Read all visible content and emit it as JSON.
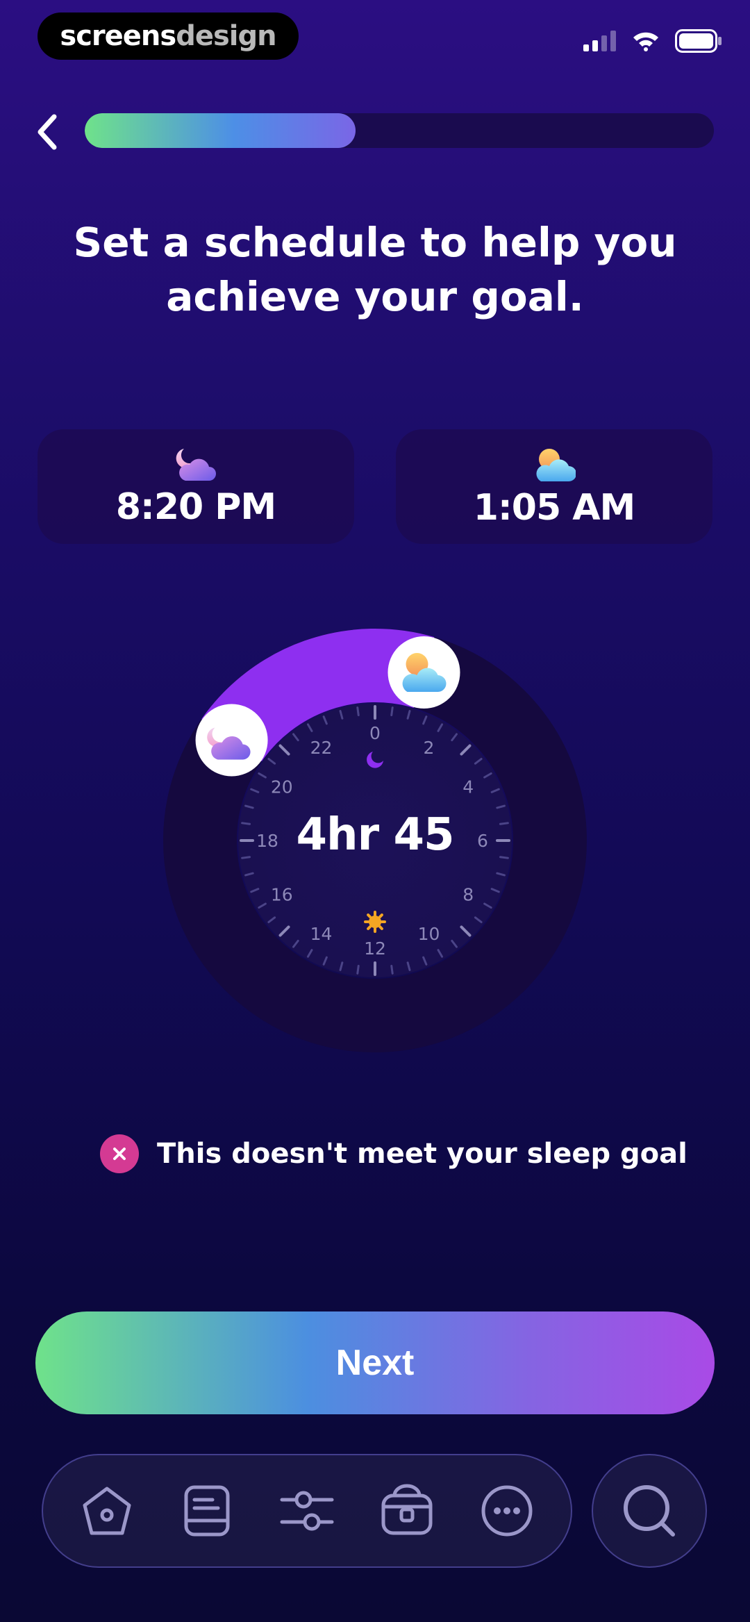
{
  "watermark": {
    "part1": "screens",
    "part2": "design"
  },
  "progress": {
    "fraction": 0.43
  },
  "title": {
    "line1": "Set a schedule to help you",
    "line2": "achieve your goal."
  },
  "bedtime": {
    "time": "8:20 PM",
    "icon": "moon-cloud-icon"
  },
  "wakeup": {
    "time": "1:05 AM",
    "icon": "sun-cloud-icon"
  },
  "dial": {
    "duration": "4hr 45",
    "hour_labels": [
      "0",
      "2",
      "4",
      "6",
      "8",
      "10",
      "12",
      "14",
      "16",
      "18",
      "20",
      "22"
    ],
    "start_hour": 20.333,
    "end_hour": 1.083
  },
  "warning": {
    "message": "This doesn't meet your sleep goal",
    "icon": "close-icon"
  },
  "next_button": {
    "label": "Next"
  },
  "tabbar": {
    "items": [
      {
        "icon": "home-icon"
      },
      {
        "icon": "journal-icon"
      },
      {
        "icon": "sliders-icon"
      },
      {
        "icon": "lock-box-icon"
      },
      {
        "icon": "more-icon"
      }
    ],
    "search_icon": "search-icon"
  },
  "colors": {
    "accent_purple": "#8e2ff0",
    "gradient_green": "#6fe28a",
    "gradient_blue": "#4c8fe0",
    "gradient_violet": "#a94ae6",
    "warning_pink": "#d43a93"
  }
}
